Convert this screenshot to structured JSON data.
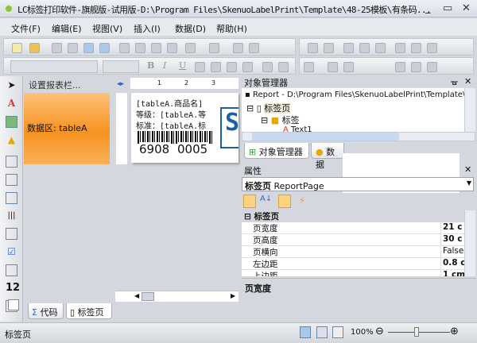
{
  "window": {
    "title": "LC标签打印软件-旗舰版-试用版-D:\\Program Files\\SkenuoLabelPrint\\Template\\48-25模板\\有条码...",
    "minimize": "_",
    "maximize": "▭",
    "close": "✕"
  },
  "menu": [
    "文件(F)",
    "编辑(E)",
    "视图(V)",
    "插入(I)",
    "数据(D)",
    "帮助(H)"
  ],
  "font_bold": "B",
  "font_italic": "I",
  "font_underline": "U",
  "band": {
    "header": "设置报表栏...",
    "name": "数据区: tableA"
  },
  "ruler": [
    "1",
    "2",
    "3"
  ],
  "label": {
    "line1": "[tableA.商品名]",
    "line2": "等级：[tableA.等",
    "line3": "标准：[tableA.标",
    "barcode_left": "6908",
    "barcode_right": "0005"
  },
  "doc_tabs": [
    "代码",
    "标签页"
  ],
  "object_manager": {
    "title": "对象管理器",
    "pin": "ᚗ",
    "close": "✕",
    "tree": [
      "Report - D:\\Program Files\\SkenuoLabelPrint\\Template\\48-25",
      "标签页",
      "标签",
      "Text1"
    ],
    "tabs": [
      "对象管理器",
      "数据"
    ]
  },
  "properties": {
    "title": "属性",
    "close": "✕",
    "selected": "标签页",
    "selected_type": "ReportPage",
    "category": "标签页",
    "rows": [
      {
        "k": "页宽度",
        "v": "21 c"
      },
      {
        "k": "页高度",
        "v": "30 c"
      },
      {
        "k": "页横向",
        "v": "False"
      },
      {
        "k": "左边距",
        "v": "0.8 c"
      },
      {
        "k": "上边距",
        "v": "1 cm"
      }
    ],
    "description": "页宽度"
  },
  "status": {
    "text": "标签页",
    "zoom": "100%"
  }
}
